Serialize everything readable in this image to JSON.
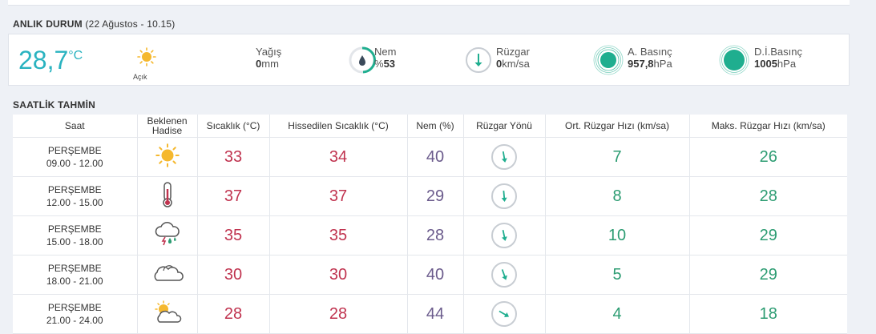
{
  "current": {
    "title": "ANLIK DURUM",
    "date": "(22 Ağustos - 10.15)",
    "temp": "28,7",
    "temp_unit": "°C",
    "condition_icon": "sun-icon",
    "condition": "Açık",
    "rain_label": "Yağış",
    "rain_value": "0",
    "rain_unit": "mm",
    "humidity_label": "Nem",
    "humidity_prefix": "%",
    "humidity_value": "53",
    "wind_label": "Rüzgar",
    "wind_value": "0",
    "wind_unit": "km/sa",
    "pressure_label": "A. Basınç",
    "pressure_value": "957,8",
    "pressure_unit": "hPa",
    "sea_pressure_label": "D.İ.Basınç",
    "sea_pressure_value": "1005",
    "sea_pressure_unit": "hPa"
  },
  "forecast": {
    "title": "SAATLİK TAHMİN",
    "headers": [
      "Saat",
      "Beklenen Hadise",
      "Sıcaklık (°C)",
      "Hissedilen Sıcaklık (°C)",
      "Nem (%)",
      "Rüzgar Yönü",
      "Ort. Rüzgar Hızı (km/sa)",
      "Maks. Rüzgar Hızı (km/sa)"
    ],
    "rows": [
      {
        "day": "PERŞEMBE",
        "hours": "09.00 - 12.00",
        "icon": "sun-icon",
        "temp": "33",
        "feels": "34",
        "humidity": "40",
        "wind_dir_deg": 170,
        "avg_wind": "7",
        "max_wind": "26"
      },
      {
        "day": "PERŞEMBE",
        "hours": "12.00 - 15.00",
        "icon": "thermometer-icon",
        "temp": "37",
        "feels": "37",
        "humidity": "29",
        "wind_dir_deg": 175,
        "avg_wind": "8",
        "max_wind": "28"
      },
      {
        "day": "PERŞEMBE",
        "hours": "15.00 - 18.00",
        "icon": "thunderstorm-icon",
        "temp": "35",
        "feels": "35",
        "humidity": "28",
        "wind_dir_deg": 168,
        "avg_wind": "10",
        "max_wind": "29"
      },
      {
        "day": "PERŞEMBE",
        "hours": "18.00 - 21.00",
        "icon": "cloud-icon",
        "temp": "30",
        "feels": "30",
        "humidity": "40",
        "wind_dir_deg": 160,
        "avg_wind": "5",
        "max_wind": "29"
      },
      {
        "day": "PERŞEMBE",
        "hours": "21.00 - 24.00",
        "icon": "partly-cloudy-icon",
        "temp": "28",
        "feels": "28",
        "humidity": "44",
        "wind_dir_deg": 120,
        "avg_wind": "4",
        "max_wind": "18"
      }
    ]
  },
  "colors": {
    "accent": "#2ab3c0",
    "temp": "#c0334f",
    "humidity": "#6b5b8c",
    "wind": "#2c9c72",
    "sun": "#f5b82e",
    "gauge": "#1fae8f"
  }
}
